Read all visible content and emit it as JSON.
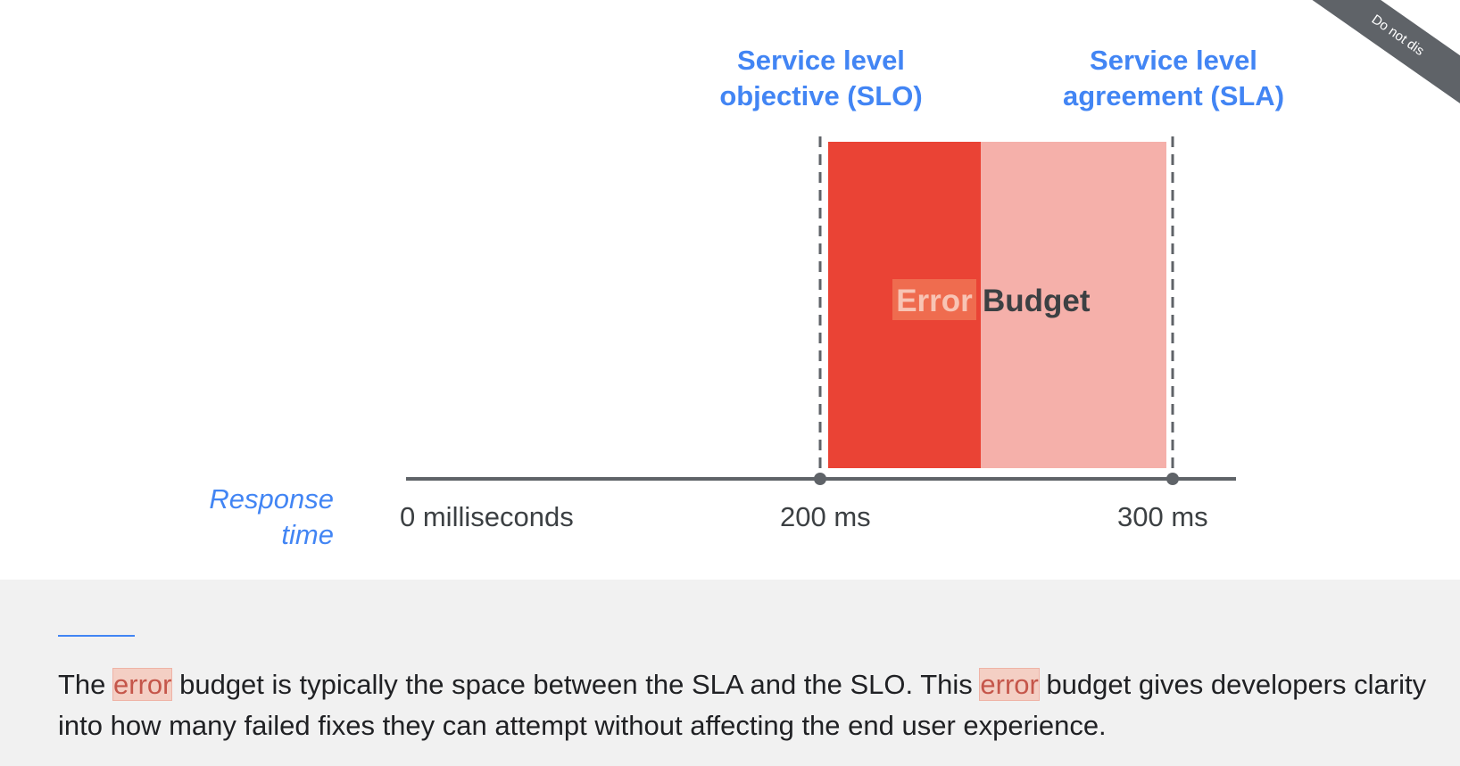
{
  "diagram": {
    "slo_label_line1": "Service level",
    "slo_label_line2": "objective (SLO)",
    "sla_label_line1": "Service level",
    "sla_label_line2": "agreement (SLA)",
    "box_word_error": "Error",
    "box_word_budget": "Budget",
    "axis_title_line1": "Response",
    "axis_title_line2": "time",
    "ticks": [
      "0 milliseconds",
      "200 ms",
      "300 ms"
    ],
    "ribbon_text": "Do not dis",
    "colors": {
      "accent_blue": "#4285f4",
      "error_red": "#ea4335",
      "budget_pink": "#f5b0aa",
      "axis_gray": "#5f6368",
      "caption_bg": "#f1f1f1"
    }
  },
  "caption": {
    "part1": "The ",
    "highlight1": "error",
    "part2": " budget is typically the space between the SLA and the SLO. This ",
    "highlight2": "error",
    "part3": " budget gives developers clarity into how many failed fixes they can attempt without affecting the end user experience."
  }
}
